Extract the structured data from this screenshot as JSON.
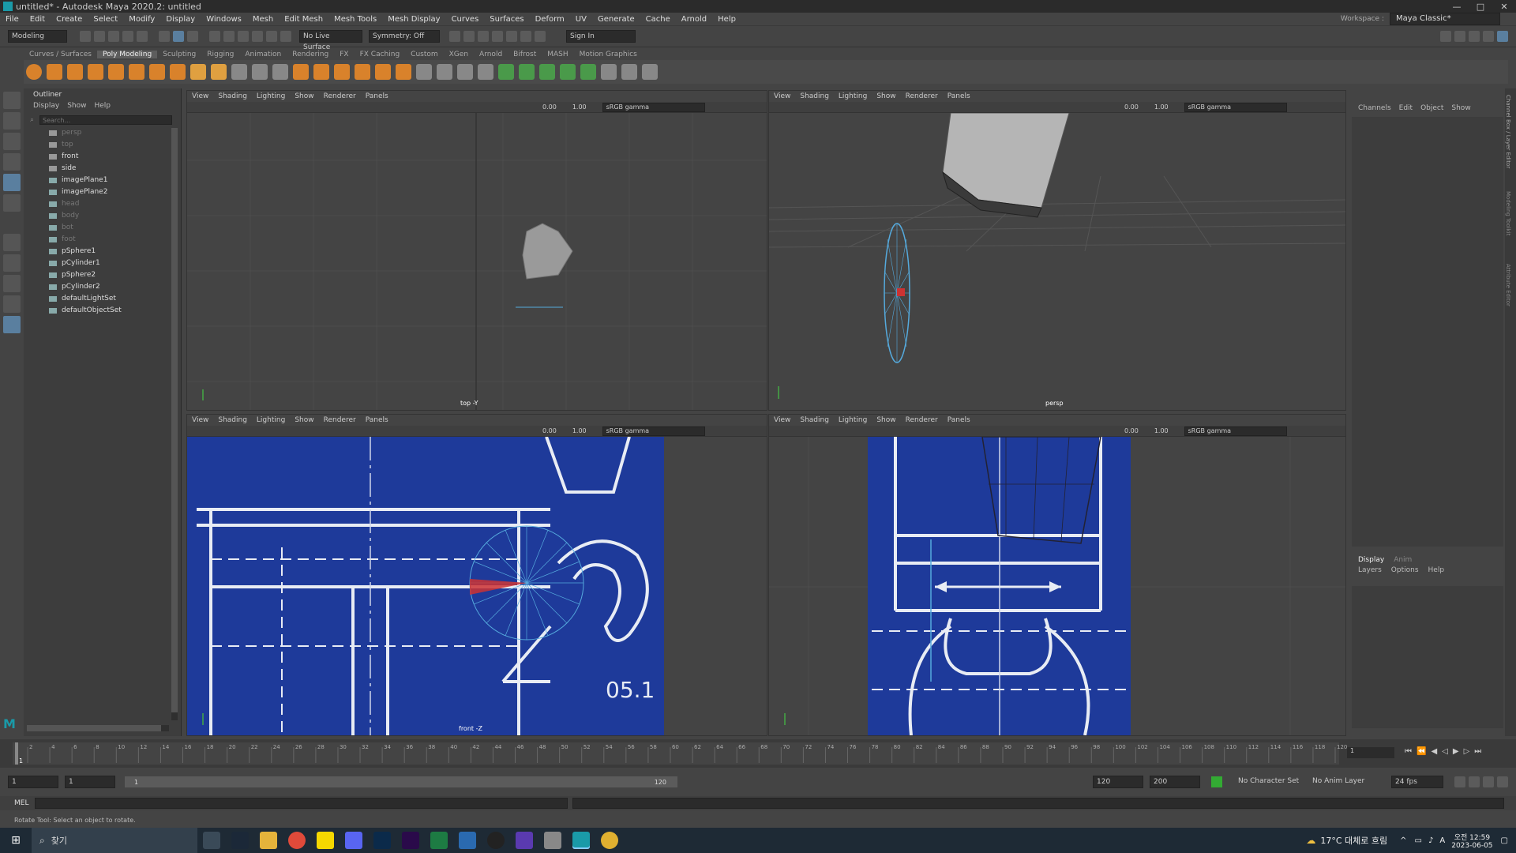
{
  "window": {
    "title": "untitled* - Autodesk Maya 2020.2: untitled",
    "controls": [
      "—",
      "□",
      "✕"
    ]
  },
  "menubar": [
    "File",
    "Edit",
    "Create",
    "Select",
    "Modify",
    "Display",
    "Windows",
    "Mesh",
    "Edit Mesh",
    "Mesh Tools",
    "Mesh Display",
    "Curves",
    "Surfaces",
    "Deform",
    "UV",
    "Generate",
    "Cache",
    "Arnold",
    "Help"
  ],
  "workspace": {
    "label": "Workspace :",
    "value": "Maya Classic*"
  },
  "statusline": {
    "mode": "Modeling",
    "live_surface": "No Live Surface",
    "symmetry": "Symmetry: Off",
    "sign_in": "Sign In"
  },
  "shelf_tabs": [
    "Curves / Surfaces",
    "Poly Modeling",
    "Sculpting",
    "Rigging",
    "Animation",
    "Rendering",
    "FX",
    "FX Caching",
    "Custom",
    "XGen",
    "Arnold",
    "Bifrost",
    "MASH",
    "Motion Graphics"
  ],
  "shelf_active": "Poly Modeling",
  "outliner": {
    "title": "Outliner",
    "menu": [
      "Display",
      "Show",
      "Help"
    ],
    "search_placeholder": "Search...",
    "items": [
      {
        "label": "persp",
        "dim": true
      },
      {
        "label": "top",
        "dim": true
      },
      {
        "label": "front",
        "dim": false
      },
      {
        "label": "side",
        "dim": false
      },
      {
        "label": "imagePlane1",
        "dim": false
      },
      {
        "label": "imagePlane2",
        "dim": false
      },
      {
        "label": "head",
        "dim": true
      },
      {
        "label": "body",
        "dim": true
      },
      {
        "label": "bot",
        "dim": true
      },
      {
        "label": "foot",
        "dim": true
      },
      {
        "label": "pSphere1",
        "dim": false
      },
      {
        "label": "pCylinder1",
        "dim": false
      },
      {
        "label": "pSphere2",
        "dim": false
      },
      {
        "label": "pCylinder2",
        "dim": false
      },
      {
        "label": "defaultLightSet",
        "dim": false
      },
      {
        "label": "defaultObjectSet",
        "dim": false
      }
    ]
  },
  "viewport_menu": [
    "View",
    "Shading",
    "Lighting",
    "Show",
    "Renderer",
    "Panels"
  ],
  "viewport_toolbar": {
    "exposure": "0.00",
    "gamma": "1.00",
    "colorspace": "sRGB gamma"
  },
  "viewports": {
    "tl": "top -Y",
    "tr": "persp",
    "bl": "front -Z",
    "br": ""
  },
  "blueprint_text": "05.1",
  "channelbox": {
    "tabs": [
      "Channels",
      "Edit",
      "Object",
      "Show"
    ],
    "layer_tabs": [
      "Display",
      "Anim"
    ],
    "layer_menu": [
      "Layers",
      "Options",
      "Help"
    ]
  },
  "side_tabs": [
    "Channel Box / Layer Editor",
    "Modeling Toolkit",
    "Attribute Editor"
  ],
  "timeline": {
    "ticks": [
      "2",
      "4",
      "6",
      "8",
      "10",
      "12",
      "14",
      "16",
      "18",
      "20",
      "22",
      "24",
      "26",
      "28",
      "30",
      "32",
      "34",
      "36",
      "38",
      "40",
      "42",
      "44",
      "46",
      "48",
      "50",
      "52",
      "54",
      "56",
      "58",
      "60",
      "62",
      "64",
      "66",
      "68",
      "70",
      "72",
      "74",
      "76",
      "78",
      "80",
      "82",
      "84",
      "86",
      "88",
      "90",
      "92",
      "94",
      "96",
      "98",
      "100",
      "102",
      "104",
      "106",
      "108",
      "110",
      "112",
      "114",
      "116",
      "118",
      "120"
    ],
    "current": "1",
    "current_field": "1"
  },
  "range": {
    "start": "1",
    "start2": "1",
    "slider_start": "1",
    "slider_end": "120",
    "end": "120",
    "end2": "200",
    "char_set": "No Character Set",
    "anim_layer": "No Anim Layer",
    "fps": "24 fps"
  },
  "mel_label": "MEL",
  "help_line": "Rotate Tool: Select an object to rotate.",
  "taskbar": {
    "search": "찾기",
    "weather": "17°C 대체로 흐림",
    "time": "오전 12:59",
    "date": "2023-06-05"
  }
}
